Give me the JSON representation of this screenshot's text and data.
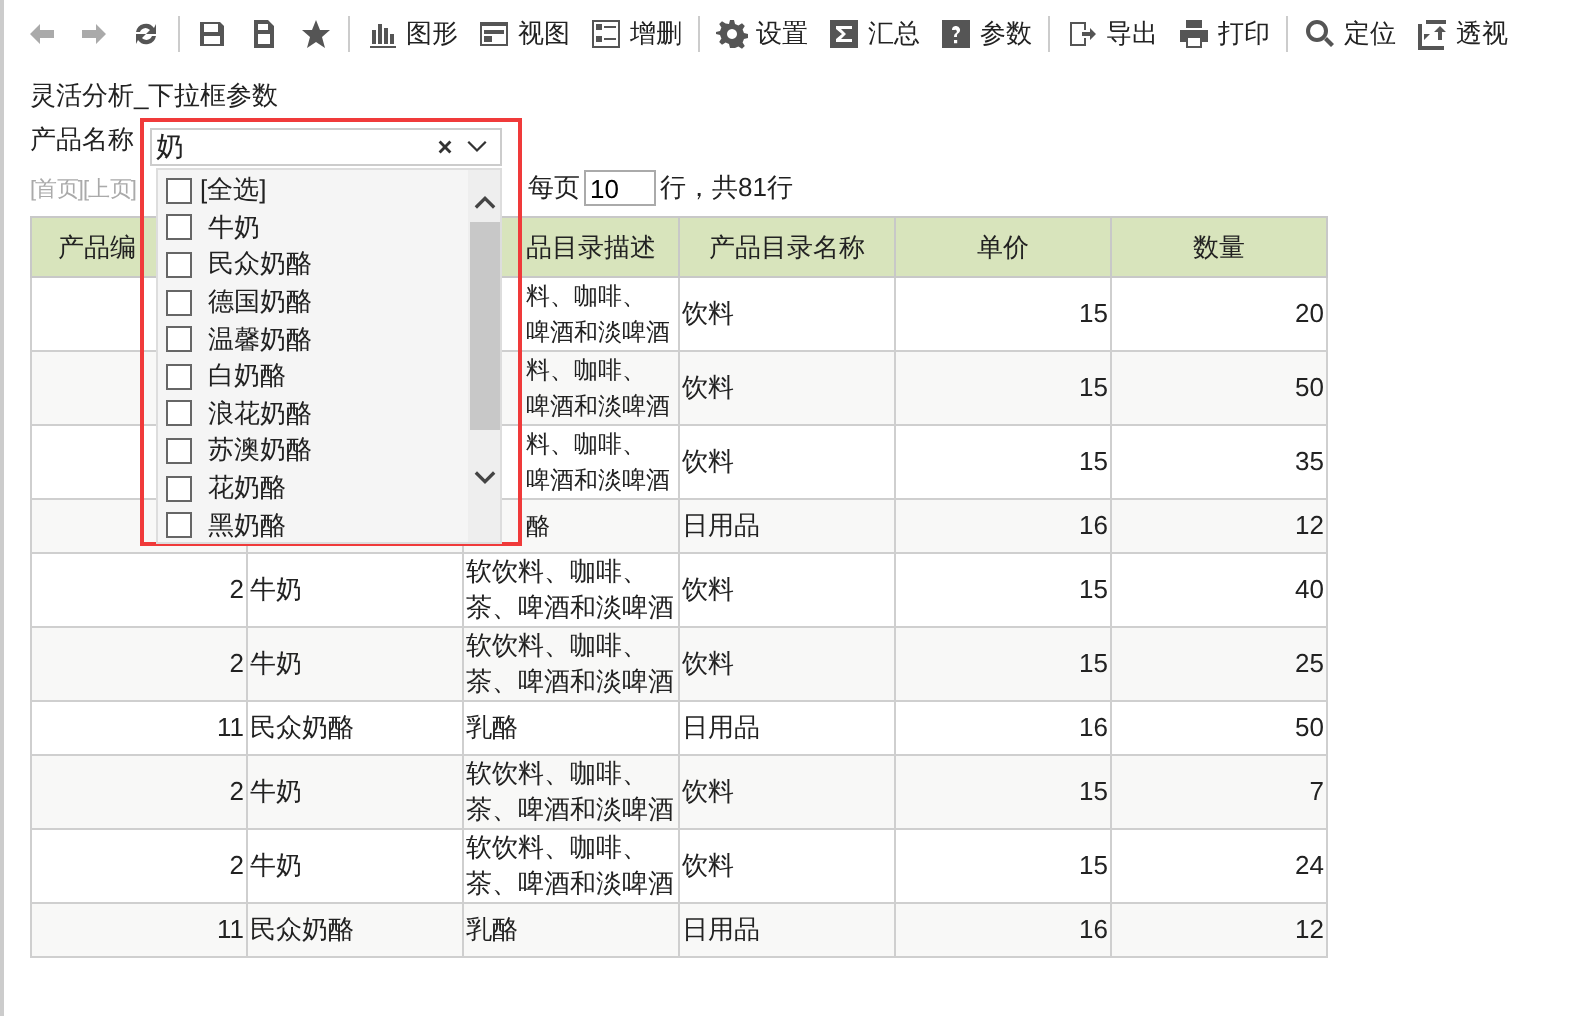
{
  "toolbar": [
    {
      "kind": "back",
      "disabled": true
    },
    {
      "kind": "forward",
      "disabled": true
    },
    {
      "kind": "refresh",
      "disabled": false
    },
    {
      "sep": true,
      "kind": "save",
      "disabled": false
    },
    {
      "kind": "saveas",
      "disabled": false
    },
    {
      "kind": "star",
      "disabled": false
    },
    {
      "sep": true,
      "kind": "chart",
      "label": "图形",
      "disabled": false
    },
    {
      "kind": "view",
      "label": "视图",
      "disabled": false
    },
    {
      "kind": "edit",
      "label": "增删",
      "disabled": false
    },
    {
      "sep": true,
      "kind": "gear",
      "label": "设置",
      "disabled": false
    },
    {
      "kind": "sigma",
      "label": "汇总",
      "disabled": false
    },
    {
      "kind": "help",
      "label": "参数",
      "disabled": false
    },
    {
      "sep": true,
      "kind": "export",
      "label": "导出",
      "disabled": false
    },
    {
      "kind": "print",
      "label": "打印",
      "disabled": false
    },
    {
      "sep": true,
      "kind": "locate",
      "label": "定位",
      "disabled": false
    },
    {
      "kind": "pivot",
      "label": "透视",
      "disabled": false
    }
  ],
  "title": "灵活分析_下拉框参数",
  "filter": {
    "label": "产品名称",
    "value": "奶",
    "options": [
      {
        "label": "[全选]",
        "checked": false,
        "all": true
      },
      {
        "label": "牛奶",
        "checked": false
      },
      {
        "label": "民众奶酪",
        "checked": false
      },
      {
        "label": "德国奶酪",
        "checked": false
      },
      {
        "label": "温馨奶酪",
        "checked": false
      },
      {
        "label": "白奶酪",
        "checked": false
      },
      {
        "label": "浪花奶酪",
        "checked": false
      },
      {
        "label": "苏澳奶酪",
        "checked": false
      },
      {
        "label": "花奶酪",
        "checked": false
      },
      {
        "label": "黑奶酪",
        "checked": false
      }
    ]
  },
  "pager": {
    "links": "[首页][上页]",
    "per_page_label": "每页",
    "per_page": "10",
    "total": "行，共81行"
  },
  "table": {
    "columns": [
      "产品编",
      "",
      "品目录描述",
      "产品目录名称",
      "单价",
      "数量"
    ],
    "rows": [
      {
        "covered": true,
        "cells": [
          [
            "料、咖啡、",
            "啤酒和淡啤酒"
          ],
          "饮料",
          "15",
          "20"
        ]
      },
      {
        "covered": true,
        "cells": [
          [
            "料、咖啡、",
            "啤酒和淡啤酒"
          ],
          "饮料",
          "15",
          "50"
        ]
      },
      {
        "covered": true,
        "cells": [
          [
            "料、咖啡、",
            "啤酒和淡啤酒"
          ],
          "饮料",
          "15",
          "35"
        ]
      },
      {
        "covered": true,
        "cells": [
          "酪",
          "日用品",
          "16",
          "12"
        ]
      },
      {
        "covered": false,
        "cells": [
          "2",
          "牛奶",
          "软饮料、咖啡、茶、啤酒和淡啤酒",
          "饮料",
          "15",
          "40"
        ]
      },
      {
        "covered": false,
        "cells": [
          "2",
          "牛奶",
          "软饮料、咖啡、茶、啤酒和淡啤酒",
          "饮料",
          "15",
          "25"
        ]
      },
      {
        "covered": false,
        "cells": [
          "11",
          "民众奶酪",
          "乳酪",
          "日用品",
          "16",
          "50"
        ]
      },
      {
        "covered": false,
        "cells": [
          "2",
          "牛奶",
          "软饮料、咖啡、茶、啤酒和淡啤酒",
          "饮料",
          "15",
          "7"
        ]
      },
      {
        "covered": false,
        "cells": [
          "2",
          "牛奶",
          "软饮料、咖啡、茶、啤酒和淡啤酒",
          "饮料",
          "15",
          "24"
        ]
      },
      {
        "covered": false,
        "cells": [
          "11",
          "民众奶酪",
          "乳酪",
          "日用品",
          "16",
          "12"
        ]
      }
    ]
  }
}
